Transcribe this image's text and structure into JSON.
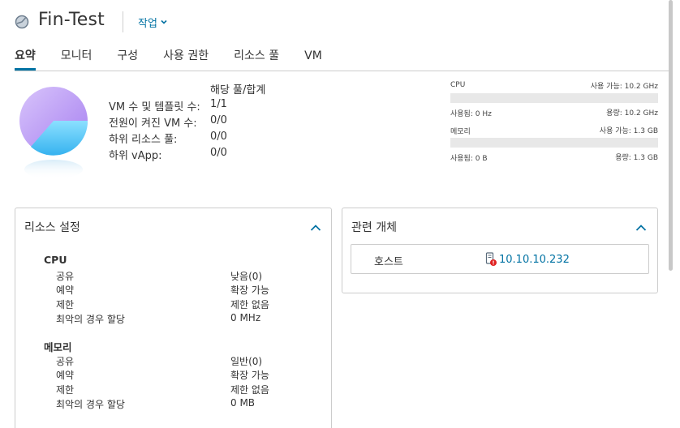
{
  "header": {
    "title": "Fin-Test",
    "actions_label": "작업"
  },
  "tabs": [
    {
      "label": "요약",
      "active": true
    },
    {
      "label": "모니터"
    },
    {
      "label": "구성"
    },
    {
      "label": "사용 권한"
    },
    {
      "label": "리소스 풀"
    },
    {
      "label": "VM"
    }
  ],
  "summary": {
    "column_header": "해당 풀/합계",
    "rows": [
      {
        "label": "VM 수 및 템플릿 수:",
        "value": "1/1"
      },
      {
        "label": "전원이 켜진 VM 수:",
        "value": "0/0"
      },
      {
        "label": "하위 리소스 풀:",
        "value": "0/0"
      },
      {
        "label": "하위 vApp:",
        "value": "0/0"
      }
    ]
  },
  "meters": [
    {
      "name": "CPU",
      "available": "사용 가능: 10.2 GHz",
      "used": "사용됨: 0 Hz",
      "capacity": "용량: 10.2 GHz",
      "used_fraction": 0
    },
    {
      "name": "메모리",
      "available": "사용 가능: 1.3 GB",
      "used": "사용됨: 0 B",
      "capacity": "용량: 1.3 GB",
      "used_fraction": 0
    }
  ],
  "resource_settings": {
    "title": "리소스 설정",
    "sections": [
      {
        "heading": "CPU",
        "rows": [
          {
            "label": "공유",
            "value": "낮음(0)"
          },
          {
            "label": "예약",
            "value": "확장 가능"
          },
          {
            "label": "제한",
            "value": "제한 없음"
          },
          {
            "label": "최악의 경우 할당",
            "value": "0 MHz"
          }
        ]
      },
      {
        "heading": "메모리",
        "rows": [
          {
            "label": "공유",
            "value": "일반(0)"
          },
          {
            "label": "예약",
            "value": "확장 가능"
          },
          {
            "label": "제한",
            "value": "제한 없음"
          },
          {
            "label": "최악의 경우 할당",
            "value": "0 MB"
          }
        ]
      }
    ]
  },
  "related_objects": {
    "title": "관련 개체",
    "host_label": "호스트",
    "host_value": "10.10.10.232"
  },
  "colors": {
    "accent": "#0072a3",
    "pie_purple": "#b48ef0",
    "pie_blue": "#4fc3f7",
    "error_red": "#e02020"
  },
  "icons": {
    "title": "resource-pool-icon",
    "actions": "chevron-down-icon",
    "collapse": "chevron-up-icon",
    "host": "host-error-icon"
  }
}
